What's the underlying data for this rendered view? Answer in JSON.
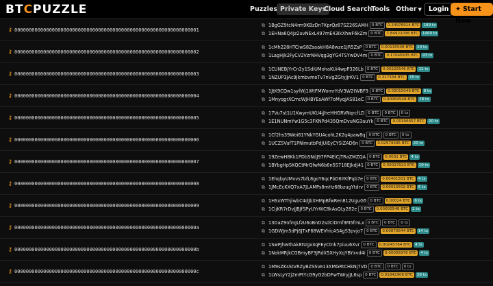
{
  "nav": {
    "logo_a": "BT",
    "logo_b": "C",
    "logo_c": "PUZZLE",
    "items": [
      "Puzzles",
      "Private Keys",
      "Cloud Search",
      "Tools",
      "Other"
    ],
    "login": "Login",
    "start": "Start Now",
    "accent": "#f7931a"
  },
  "rows": [
    {
      "key": "0000000000000000000000000000000000000000000000000000000000000001",
      "a1": {
        "addr": "1BgGZ9tcN4rm9KBzDn7KprQz87SZ26SAMH",
        "btc": "0 BTC",
        "amt": "0.24976914 BTC",
        "tx": "189 tx"
      },
      "a2": {
        "addr": "1EHNa6Q4Jz2uvNExL497mE43ikXhwF6kZm",
        "btc": "0 BTC",
        "amt": "7.84922036 BTC",
        "tx": "1469 tx"
      }
    },
    {
      "key": "0000000000000000000000000000000000000000000000000000000000000002",
      "a1": {
        "addr": "1cMh228HTCiwS8ZsaakH8A8wze1JR5ZsP",
        "btc": "0 BTC",
        "amt": "0.00130508 BTC",
        "tx": "14 tx"
      },
      "a2": {
        "addr": "1LagHJk2FyCV2VzrNHVqg3gYG4TSYwDV4m",
        "btc": "0 BTC",
        "amt": "0.17045635 BTC",
        "tx": "93 tx"
      }
    },
    {
      "key": "0000000000000000000000000000000000000000000000000000000000000003",
      "a1": {
        "addr": "1CUNEBjYrCn2y1SdiUMohaKUi4wpP326Lb",
        "btc": "0 BTC",
        "amt": "0.00226546 BTC",
        "tx": "12 tx"
      },
      "a2": {
        "addr": "1NZUP3JAc9JkmbvmoTv7nVgZGtyJjrKV1",
        "btc": "0 BTC",
        "amt": "0.317334 BTC",
        "tx": "78 tx"
      }
    },
    {
      "key": "0000000000000000000000000000000000000000000000000000000000000004",
      "a1": {
        "addr": "1JtK9CQw1syfWj1WtFMWomrYdV3W2tWBF9",
        "btc": "0 BTC",
        "amt": "0.00015049 BTC",
        "tx": "8 tx"
      },
      "a2": {
        "addr": "1MnyqgrXCmcWJHBYEsAWf7oMyqJAS81eC",
        "btc": "0 BTC",
        "amt": "0.00064548 BTC",
        "tx": "18 tx"
      }
    },
    {
      "key": "0000000000000000000000000000000000000000000000000000000000000005",
      "a1": {
        "addr": "17Vu7st1U1KwymUKU4jJheHHGRVNqrcfLD",
        "btc": "0 BTC",
        "amt": "0 BTC",
        "tx": "0 tx"
      },
      "a2": {
        "addr": "1E1NUNmYw1G5c3FKNPd435QmDvuNG3auYk",
        "btc": "0 BTC",
        "amt": "0.00306657 BTC",
        "tx": "20 tx"
      }
    },
    {
      "key": "0000000000000000000000000000000000000000000000000000000000000006",
      "a1": {
        "addr": "1Cf2hs39Woi61YNkYGUAcohL2K2q4paw8q",
        "btc": "0 BTC",
        "amt": "0 BTC",
        "tx": "0 tx"
      },
      "a2": {
        "addr": "1UCZSVufT1PNimutbPdJUiEyCYSiZAD6n",
        "btc": "0 BTC",
        "amt": "0.02579395 BTC",
        "tx": "20 tx"
      }
    },
    {
      "key": "0000000000000000000000000000000000000000000000000000000000000007",
      "a1": {
        "addr": "19ZewH8Kk1PDbSNdJ97FP4EiCjTRaZMZQA",
        "btc": "0 BTC",
        "amt": "0.0031 BTC",
        "tx": "4 tx"
      },
      "a2": {
        "addr": "1BYbgHpSKQCtMrQfwN6b6n5S718EJkdJ41",
        "btc": "0 BTC",
        "amt": "0.00027023 BTC",
        "tx": "10 tx"
      }
    },
    {
      "key": "0000000000000000000000000000000000000000000000000000000000000008",
      "a1": {
        "addr": "1EhqbyUMvvs7bfL8goY6qcPbD6YKfPqb7e",
        "btc": "0 BTC",
        "amt": "0.00401501 BTC",
        "tx": "4 tx"
      },
      "a2": {
        "addr": "1JMcEcKXQ7xA7JLAMPs8mHz68bzugYtdrv",
        "btc": "0 BTC",
        "amt": "0.00015502 BTC",
        "tx": "6 tx"
      }
    },
    {
      "key": "0000000000000000000000000000000000000000000000000000000000000009",
      "a1": {
        "addr": "1HSxWThjiwbC4dJbXHMpBfwRen812UguG5",
        "btc": "0 BTC",
        "amt": "0.00024 BTC",
        "tx": "6 tx"
      },
      "a2": {
        "addr": "1CijKR7rDvJJBJfSPyUYrWC8kAsQLy282e",
        "btc": "0 BTC",
        "amt": "0.00000548 BTC",
        "tx": "2 tx"
      }
    },
    {
      "key": "000000000000000000000000000000000000000000000000000000000000000a",
      "a1": {
        "addr": "13DaZ9nfmJLfzU6oBnD2sdCiDmf3M5fmLx",
        "btc": "0 BTC",
        "amt": "0 BTC",
        "tx": "0 tx"
      },
      "a2": {
        "addr": "1GDWJm5dPj6JTxF68WEVhicAS4gS3pvjo7",
        "btc": "0 BTC",
        "amt": "0.00870644 BTC",
        "tx": "14 tx"
      }
    },
    {
      "key": "000000000000000000000000000000000000000000000000000000000000000b",
      "a1": {
        "addr": "1SwPJhwthAk8tUgx3qFEyCtnk7piuu6Xvr",
        "btc": "0 BTC",
        "amt": "0.00245764 BTC",
        "tx": "4 tx"
      },
      "a2": {
        "addr": "1NokMRjkCGBmyBF3JRdX5XHyXqYBYxvd4i",
        "btc": "0 BTC",
        "amt": "0.00005976 BTC",
        "tx": "4 tx"
      }
    },
    {
      "key": "000000000000000000000000000000000000000000000000000000000000000c",
      "a1": {
        "addr": "1M9sZKsStVRZyBZSSVe13XMGRtCHkNj7VD",
        "btc": "0 BTC",
        "amt": "0 BTC",
        "tx": "0 tx"
      },
      "a2": {
        "addr": "1LWsLyY2j2mPtYcG9yG2bDFwTWryjJL6sp",
        "btc": "0 BTC",
        "amt": "0.01842906 BTC",
        "tx": "38 tx"
      }
    }
  ]
}
